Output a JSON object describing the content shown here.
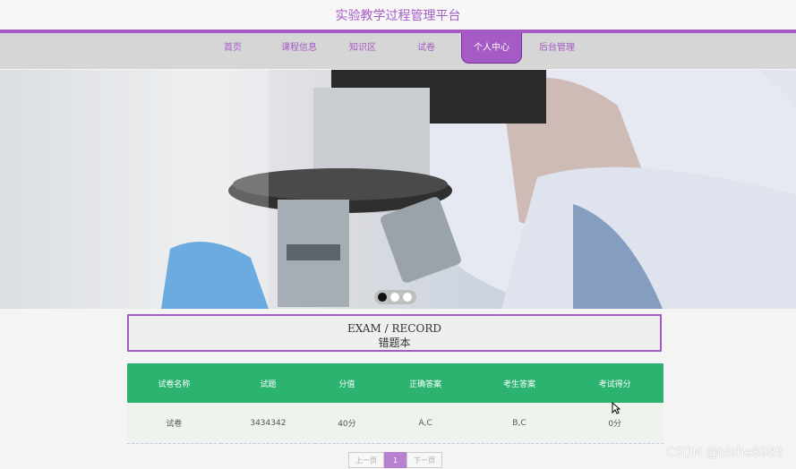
{
  "site": {
    "title": "实验教学过程管理平台"
  },
  "nav": {
    "items": [
      "首页",
      "课程信息",
      "知识区",
      "试卷",
      "个人中心",
      "后台管理"
    ],
    "active_index": 4
  },
  "banner": {
    "slide_count": 3,
    "active_slide": 0
  },
  "section": {
    "title_en": "EXAM / RECORD",
    "title_zh": "错题本"
  },
  "table": {
    "headers": [
      "试卷名称",
      "试题",
      "分值",
      "正确答案",
      "考生答案",
      "考试得分"
    ],
    "rows": [
      [
        "试卷",
        "3434342",
        "40分",
        "A,C",
        "B,C",
        "0分"
      ]
    ]
  },
  "pagination": {
    "prev": "上一页",
    "current": "1",
    "next": "下一页"
  },
  "watermark": "CSDN @bishe8989",
  "colors": {
    "accent": "#a55bc6",
    "table_header": "#2db370"
  }
}
